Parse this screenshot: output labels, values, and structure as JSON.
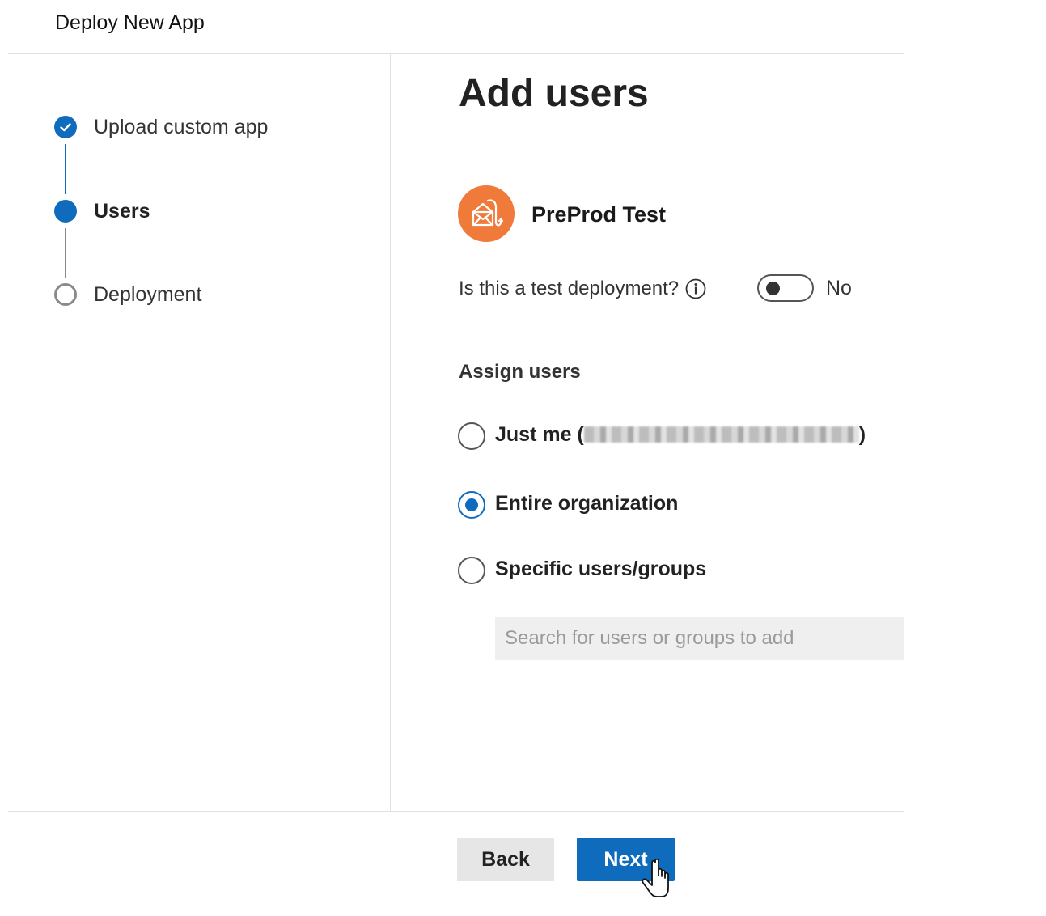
{
  "window": {
    "title": "Deploy New App"
  },
  "stepper": {
    "steps": [
      {
        "label": "Upload custom app",
        "state": "completed"
      },
      {
        "label": "Users",
        "state": "current"
      },
      {
        "label": "Deployment",
        "state": "pending"
      }
    ]
  },
  "main": {
    "heading": "Add users",
    "app": {
      "name": "PreProd Test",
      "icon": "phishing-mail-icon",
      "icon_color": "#f07a3a"
    },
    "test_deployment": {
      "question": "Is this a test deployment?",
      "toggle_value": "No",
      "on": false
    },
    "assign": {
      "label": "Assign users",
      "options": [
        {
          "label": "Just me (",
          "suffix": ")",
          "redacted": true,
          "selected": false
        },
        {
          "label": "Entire organization",
          "selected": true
        },
        {
          "label": "Specific users/groups",
          "selected": false
        }
      ],
      "search_placeholder": "Search for users or groups to add"
    }
  },
  "footer": {
    "back_label": "Back",
    "next_label": "Next"
  },
  "colors": {
    "accent": "#0f6cbd",
    "divider": "#e1e1e1"
  }
}
